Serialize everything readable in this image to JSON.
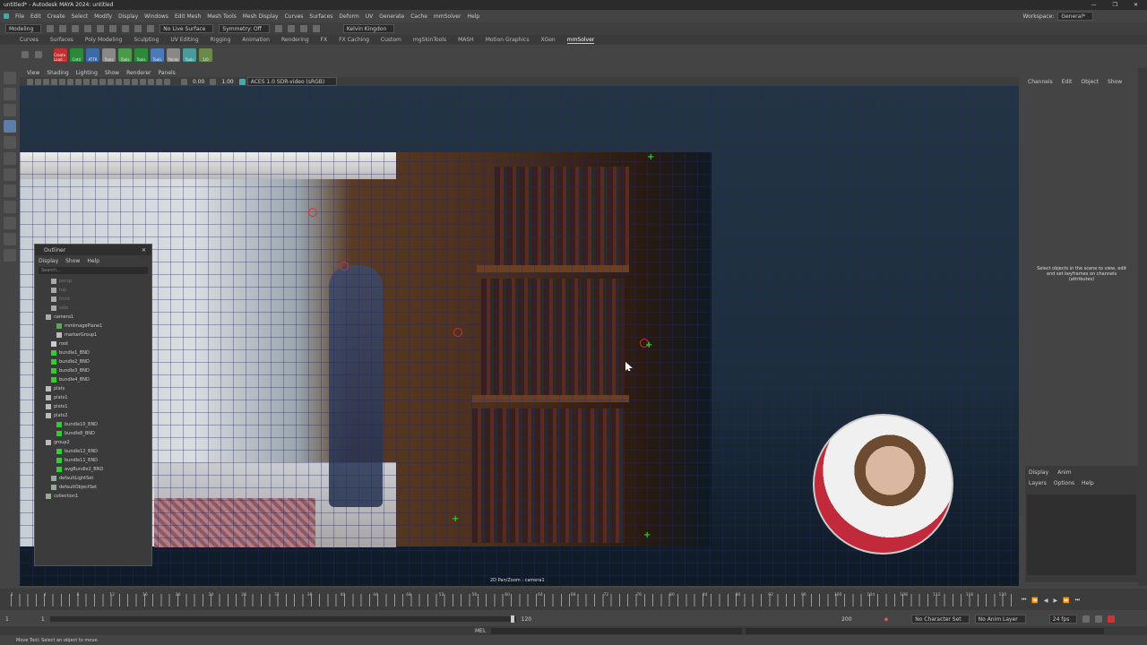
{
  "window": {
    "title": "untitled* - Autodesk MAYA 2024: untitled",
    "controls": [
      "—",
      "❐",
      "✕"
    ]
  },
  "menubar": {
    "items": [
      "File",
      "Edit",
      "Create",
      "Select",
      "Modify",
      "Display",
      "Windows",
      "Edit Mesh",
      "Mesh Tools",
      "Mesh Display",
      "Curves",
      "Surfaces",
      "Deform",
      "UV",
      "Generate",
      "Cache",
      "mmSolver",
      "Help"
    ],
    "workspace_label": "Workspace:",
    "workspace_value": "General*"
  },
  "statusline": {
    "mode": "Modeling",
    "live_surface": "No Live Surface",
    "symmetry": "Symmetry: Off",
    "user": "Kelvin Kingdon"
  },
  "shelf": {
    "tabs": [
      "Curves",
      "Surfaces",
      "Poly Modeling",
      "Sculpting",
      "UV Editing",
      "Rigging",
      "Animation",
      "Rendering",
      "FX",
      "FX Caching",
      "Custom",
      "mgSkinTools",
      "MASH",
      "Motion Graphics",
      "XGen",
      "mmSolver"
    ],
    "active_tab": "mmSolver",
    "buttons": [
      "Create Load...",
      "Cntrl",
      "ATTR",
      "Tools",
      "Tools",
      "Tools",
      "Tools",
      "Points",
      "Tools",
      "1/0"
    ]
  },
  "panel": {
    "menus": [
      "View",
      "Shading",
      "Lighting",
      "Show",
      "Renderer",
      "Panels"
    ],
    "field_a": "0.00",
    "field_b": "1.00",
    "colorspace": "ACES 1.0 SDR-video (sRGB)",
    "label": "2D Pan/Zoom : camera1"
  },
  "channelbox": {
    "menus": [
      "Channels",
      "Edit",
      "Object",
      "Show"
    ],
    "message": "Select objects in the scene to view, edit and set keyframes on channels (attributes)"
  },
  "layers": {
    "tabs": [
      "Display",
      "Anim"
    ],
    "menus": [
      "Layers",
      "Options",
      "Help"
    ]
  },
  "outliner": {
    "title": "Outliner",
    "menus": [
      "Display",
      "Show",
      "Help"
    ],
    "search_placeholder": "Search...",
    "items": [
      {
        "label": "persp",
        "indent": 1,
        "dim": true,
        "icon": "camera"
      },
      {
        "label": "top",
        "indent": 1,
        "dim": true,
        "icon": "camera"
      },
      {
        "label": "front",
        "indent": 1,
        "dim": true,
        "icon": "camera"
      },
      {
        "label": "side",
        "indent": 1,
        "dim": true,
        "icon": "camera"
      },
      {
        "label": "camera1",
        "indent": 0,
        "dim": false,
        "icon": "camera"
      },
      {
        "label": "mmImagePlane1",
        "indent": 2,
        "dim": false,
        "icon": "plane"
      },
      {
        "label": "markerGroup1",
        "indent": 2,
        "dim": false,
        "icon": "group"
      },
      {
        "label": "root",
        "indent": 1,
        "dim": false,
        "icon": "locator"
      },
      {
        "label": "bundle1_BND",
        "indent": 1,
        "dim": false,
        "icon": "bundle"
      },
      {
        "label": "bundle2_BND",
        "indent": 1,
        "dim": false,
        "icon": "bundle"
      },
      {
        "label": "bundle3_BND",
        "indent": 1,
        "dim": false,
        "icon": "bundle"
      },
      {
        "label": "bundle4_BND",
        "indent": 1,
        "dim": false,
        "icon": "bundle"
      },
      {
        "label": "plats",
        "indent": 0,
        "dim": false,
        "icon": "group"
      },
      {
        "label": "plats1",
        "indent": 0,
        "dim": false,
        "icon": "group"
      },
      {
        "label": "plats1",
        "indent": 0,
        "dim": false,
        "icon": "group"
      },
      {
        "label": "plats2",
        "indent": 0,
        "dim": false,
        "icon": "group"
      },
      {
        "label": "bundle10_BND",
        "indent": 2,
        "dim": false,
        "icon": "bundle"
      },
      {
        "label": "bundle8_BND",
        "indent": 2,
        "dim": false,
        "icon": "bundle"
      },
      {
        "label": "group2",
        "indent": 0,
        "dim": false,
        "icon": "group"
      },
      {
        "label": "bundle12_BND",
        "indent": 2,
        "dim": false,
        "icon": "bundle"
      },
      {
        "label": "bundle11_BND",
        "indent": 2,
        "dim": false,
        "icon": "bundle"
      },
      {
        "label": "avgBundle2_BND",
        "indent": 2,
        "dim": false,
        "icon": "bundle"
      },
      {
        "label": "defaultLightSet",
        "indent": 1,
        "dim": false,
        "icon": "set"
      },
      {
        "label": "defaultObjectSet",
        "indent": 1,
        "dim": false,
        "icon": "set"
      },
      {
        "label": "collection1",
        "indent": 0,
        "dim": false,
        "icon": "set"
      }
    ]
  },
  "timeslider": {
    "tick_labels": [
      "1",
      "4",
      "8",
      "12",
      "16",
      "20",
      "24",
      "28",
      "32",
      "36",
      "40",
      "44",
      "48",
      "52",
      "56",
      "60",
      "64",
      "68",
      "72",
      "76",
      "80",
      "84",
      "88",
      "92",
      "96",
      "100",
      "104",
      "108",
      "112",
      "116",
      "120"
    ],
    "current_frame": "1"
  },
  "range": {
    "start": "1",
    "start_inner": "1",
    "end_inner": "120",
    "end": "200",
    "character_set": "No Character Set",
    "anim_layer": "No Anim Layer",
    "fps": "24 fps"
  },
  "melbar": {
    "label": "MEL"
  },
  "helpline": {
    "text": "Move Tool: Select an object to move."
  },
  "colors": {
    "accent": "#5c7ea8",
    "bundle_green": "#33cc33",
    "marker_red": "#cc3333"
  }
}
